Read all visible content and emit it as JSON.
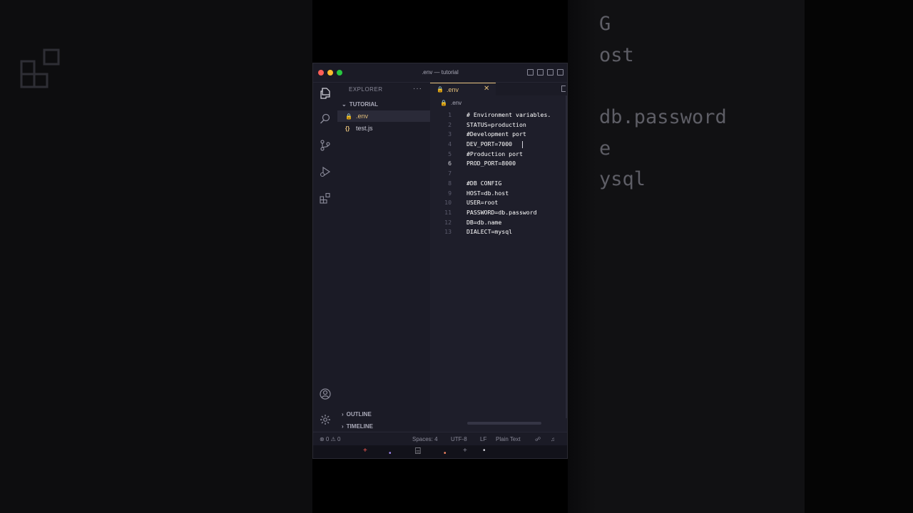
{
  "background": {
    "right_code_lines": [
      "G",
      "ost",
      "db.password",
      "e",
      "ysql"
    ]
  },
  "window": {
    "title": ".env — tutorial"
  },
  "sidebar": {
    "title": "EXPLORER",
    "more": "···",
    "folder": "TUTORIAL",
    "files": [
      {
        "icon": "🔒",
        "name": ".env"
      },
      {
        "icon": "{}",
        "name": "test.js"
      }
    ],
    "outline": "OUTLINE",
    "timeline": "TIMELINE"
  },
  "editor": {
    "tab_label": ".env",
    "tab_close": "✕",
    "breadcrumb": ".env",
    "current_line": 6,
    "lines": [
      {
        "n": "1",
        "text": "# Environment variables."
      },
      {
        "n": "2",
        "text": "STATUS=production"
      },
      {
        "n": "3",
        "text": "#Development port"
      },
      {
        "n": "4",
        "text": "DEV_PORT=7000"
      },
      {
        "n": "5",
        "text": "#Production port"
      },
      {
        "n": "6",
        "text": "PROD_PORT=8000"
      },
      {
        "n": "7",
        "text": ""
      },
      {
        "n": "8",
        "text": "#DB CONFIG"
      },
      {
        "n": "9",
        "text": "HOST=db.host"
      },
      {
        "n": "10",
        "text": "USER=root"
      },
      {
        "n": "11",
        "text": "PASSWORD=db.password"
      },
      {
        "n": "12",
        "text": "DB=db.name"
      },
      {
        "n": "13",
        "text": "DIALECT=mysql"
      }
    ]
  },
  "statusbar": {
    "problems": "⊗ 0 ⚠ 0",
    "spaces": "Spaces: 4",
    "encoding": "UTF-8",
    "eol": "LF",
    "language": "Plain Text"
  },
  "colors": {
    "accent": "#e5c07b",
    "editor_bg": "#1e1e2a",
    "panel_bg": "#1b1b26"
  }
}
